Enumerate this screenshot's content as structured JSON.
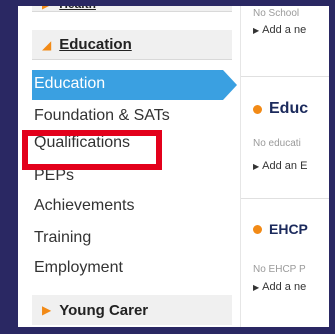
{
  "sidebar": {
    "top_section": "Health",
    "education_section": "Education",
    "active_item": "Education",
    "items": [
      "Foundation & SATs",
      "Qualifications",
      "PEPs",
      "Achievements",
      "Training",
      "Employment"
    ],
    "young_carer_section": "Young Carer"
  },
  "content": {
    "top_status": "No School",
    "top_add": "Add a ne",
    "education_heading": "Educ",
    "education_status": "No educati",
    "education_add": "Add an E",
    "ehcp_heading": "EHCP",
    "ehcp_status": "No EHCP P",
    "ehcp_add": "Add a ne"
  },
  "colors": {
    "accent": "#3aa0e1",
    "arrow": "#f28a16",
    "highlight": "#e3001b",
    "frame": "#2a2863"
  }
}
